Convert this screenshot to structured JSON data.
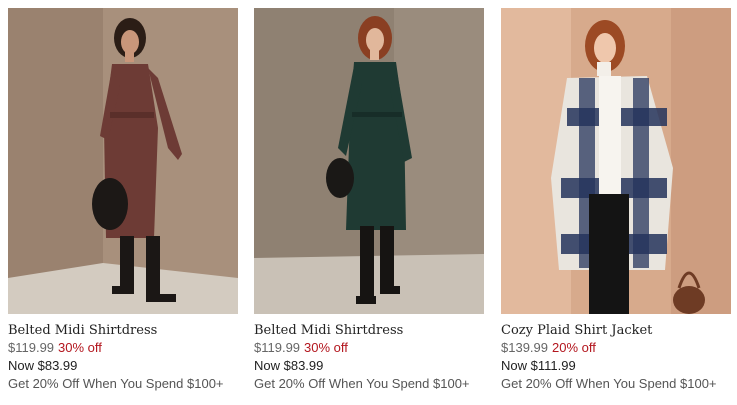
{
  "products": [
    {
      "name": "Belted Midi Shirtdress",
      "original_price": "$119.99",
      "discount": "30% off",
      "sale_price": "Now $83.99",
      "promo": "Get 20% Off When You Spend $100+",
      "image": "woman-in-burgundy-midi-dress"
    },
    {
      "name": "Belted Midi Shirtdress",
      "original_price": "$119.99",
      "discount": "30% off",
      "sale_price": "Now $83.99",
      "promo": "Get 20% Off When You Spend $100+",
      "image": "woman-in-dark-green-midi-dress"
    },
    {
      "name": "Cozy Plaid Shirt Jacket",
      "original_price": "$139.99",
      "discount": "20% off",
      "sale_price": "Now $111.99",
      "promo": "Get 20% Off When You Spend $100+",
      "image": "woman-in-navy-plaid-shirt-jacket"
    }
  ],
  "colors": {
    "discount": "#b3161e",
    "text": "#222222",
    "muted": "#666666"
  }
}
